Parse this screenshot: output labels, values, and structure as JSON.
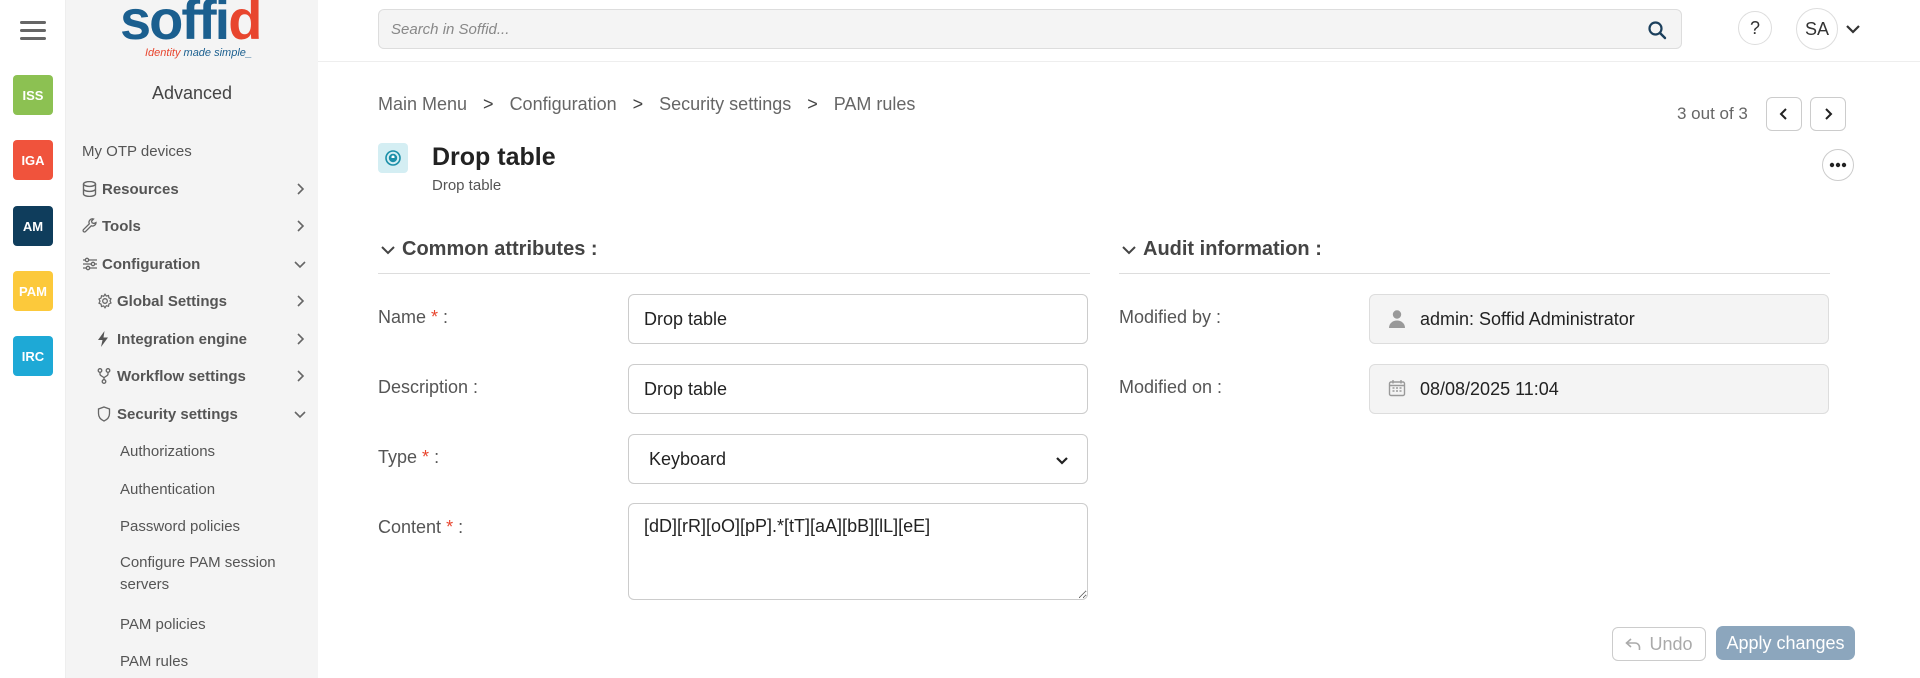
{
  "rail": {
    "items": [
      {
        "label": "ISS",
        "color": "#8cc152"
      },
      {
        "label": "IGA",
        "color": "#f0533c"
      },
      {
        "label": "AM",
        "color": "#0f3d5c"
      },
      {
        "label": "PAM",
        "color": "#fcc93b"
      },
      {
        "label": "IRC",
        "color": "#1ea9d6"
      }
    ]
  },
  "logo": {
    "wordmark_pre": "soffi",
    "wordmark_dot": "d",
    "tag_pre": "Identity",
    "tag_post": " made simple_"
  },
  "sidebar": {
    "mode": "Advanced",
    "items": [
      {
        "label": "My OTP devices"
      },
      {
        "label": "Resources",
        "icon": "database-icon"
      },
      {
        "label": "Tools",
        "icon": "wrench-icon"
      },
      {
        "label": "Configuration",
        "icon": "sliders-icon"
      },
      {
        "label": "Global Settings",
        "icon": "gear-icon"
      },
      {
        "label": "Integration engine",
        "icon": "bolt-icon"
      },
      {
        "label": "Workflow settings",
        "icon": "workflow-icon"
      },
      {
        "label": "Security settings",
        "icon": "shield-icon"
      },
      {
        "label": "Authorizations"
      },
      {
        "label": "Authentication"
      },
      {
        "label": "Password policies"
      },
      {
        "label": "Configure PAM session servers"
      },
      {
        "label": "PAM policies"
      },
      {
        "label": "PAM rules"
      }
    ]
  },
  "search": {
    "placeholder": "Search in Soffid..."
  },
  "header": {
    "help": "?",
    "avatar": "SA"
  },
  "breadcrumb": [
    "Main Menu",
    "Configuration",
    "Security settings",
    "PAM rules"
  ],
  "breadcrumb_sep": ">",
  "pager": {
    "text": "3 out of 3"
  },
  "page": {
    "title": "Drop table",
    "subtitle": "Drop table"
  },
  "sections": {
    "common": "Common attributes :",
    "audit": "Audit information :"
  },
  "form": {
    "name_label": "Name",
    "name_value": "Drop table",
    "description_label": "Description :",
    "description_value": "Drop table",
    "type_label": "Type",
    "type_value": "Keyboard",
    "content_label": "Content",
    "content_value": "[dD][rR][oO][pP].*[tT][aA][bB][lL][eE]",
    "required_mark": "*",
    "label_suffix": " :"
  },
  "audit": {
    "modified_by_label": "Modified by :",
    "modified_by_value": "admin: Soffid Administrator",
    "modified_on_label": "Modified on :",
    "modified_on_value": "08/08/2025 11:04"
  },
  "actions": {
    "undo": "Undo",
    "apply": "Apply changes"
  }
}
